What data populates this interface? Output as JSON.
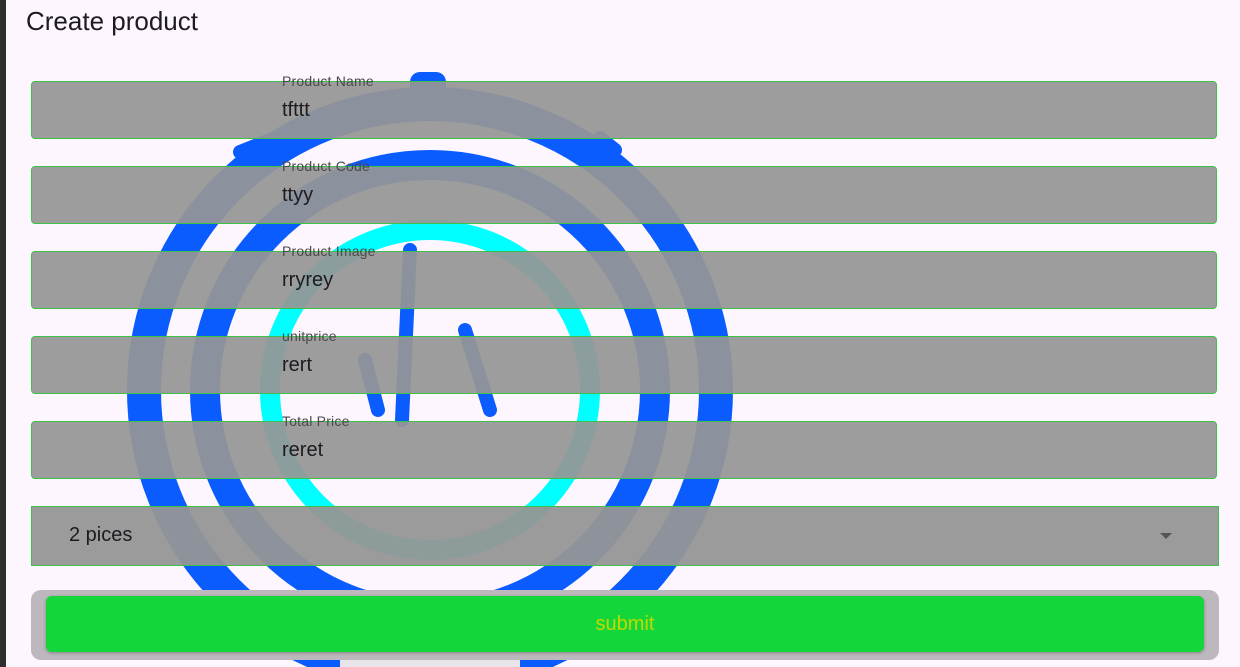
{
  "page": {
    "title": "Create product"
  },
  "form": {
    "fields": [
      {
        "label": "Product Name",
        "value": "tfttt"
      },
      {
        "label": "Product Code",
        "value": "ttyy"
      },
      {
        "label": "Product Image",
        "value": "rryrey"
      },
      {
        "label": "unitprice",
        "value": "rert"
      },
      {
        "label": "Total Price",
        "value": "reret"
      }
    ],
    "quantity_select": {
      "selected": "2 pices"
    },
    "submit_label": "submit"
  },
  "colors": {
    "background": "#fdf6fe",
    "field_bg": "#969696",
    "field_border": "#3cc24a",
    "submit_bg": "#13d63a",
    "submit_text": "#c3d800",
    "art_blue": "#0a5cff",
    "art_cyan": "#00ffff"
  }
}
